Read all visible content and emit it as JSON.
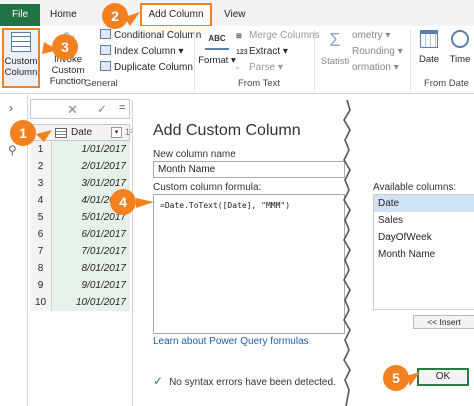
{
  "tabs": {
    "file": "File",
    "home": "Home",
    "add_column": "Add Column",
    "view": "View"
  },
  "ribbon": {
    "general": {
      "custom_column": "Custom Column",
      "invoke_custom_function": "Invoke Custom Function",
      "conditional_column": "Conditional Column",
      "index_column": "Index Column",
      "duplicate_column": "Duplicate Column",
      "group_label": "General"
    },
    "from_text": {
      "format": "Format",
      "merge_columns": "Merge Columns",
      "extract": "Extract",
      "parse": "Parse",
      "group_label": "From Text"
    },
    "from_number": {
      "statistics": "Statisti",
      "trigonometry": "ometry",
      "rounding": "Rounding",
      "information": "ormation"
    },
    "from_date": {
      "date": "Date",
      "time": "Time",
      "group_label": "From Date"
    }
  },
  "formula_bar": {
    "equals": "="
  },
  "grid": {
    "column_header": "Date",
    "next_column_hint": "1²",
    "rows": [
      {
        "num": "1",
        "date": "1/01/2017"
      },
      {
        "num": "2",
        "date": "2/01/2017"
      },
      {
        "num": "3",
        "date": "3/01/2017"
      },
      {
        "num": "4",
        "date": "4/01/2017"
      },
      {
        "num": "5",
        "date": "5/01/2017"
      },
      {
        "num": "6",
        "date": "6/01/2017"
      },
      {
        "num": "7",
        "date": "7/01/2017"
      },
      {
        "num": "8",
        "date": "8/01/2017"
      },
      {
        "num": "9",
        "date": "9/01/2017"
      },
      {
        "num": "10",
        "date": "10/01/2017"
      }
    ]
  },
  "dialog": {
    "title": "Add Custom Column",
    "new_column_name_label": "New column name",
    "new_column_name_value": "Month Name",
    "formula_label": "Custom column formula:",
    "formula_value": "=Date.ToText([Date], \"MMM\")",
    "available_columns_label": "Available columns:",
    "available_columns": [
      "Date",
      "Sales",
      "DayOfWeek",
      "Month Name"
    ],
    "selected_column": "Date",
    "insert_button": "<< Insert",
    "learn_link": "Learn about Power Query formulas",
    "syntax_status": "No syntax errors have been detected.",
    "ok_button": "OK"
  },
  "callouts": [
    "1",
    "2",
    "3",
    "4",
    "5"
  ],
  "colors": {
    "accent_orange": "#f48120",
    "excel_green": "#217346",
    "selected_row": "#cfe3f4"
  }
}
